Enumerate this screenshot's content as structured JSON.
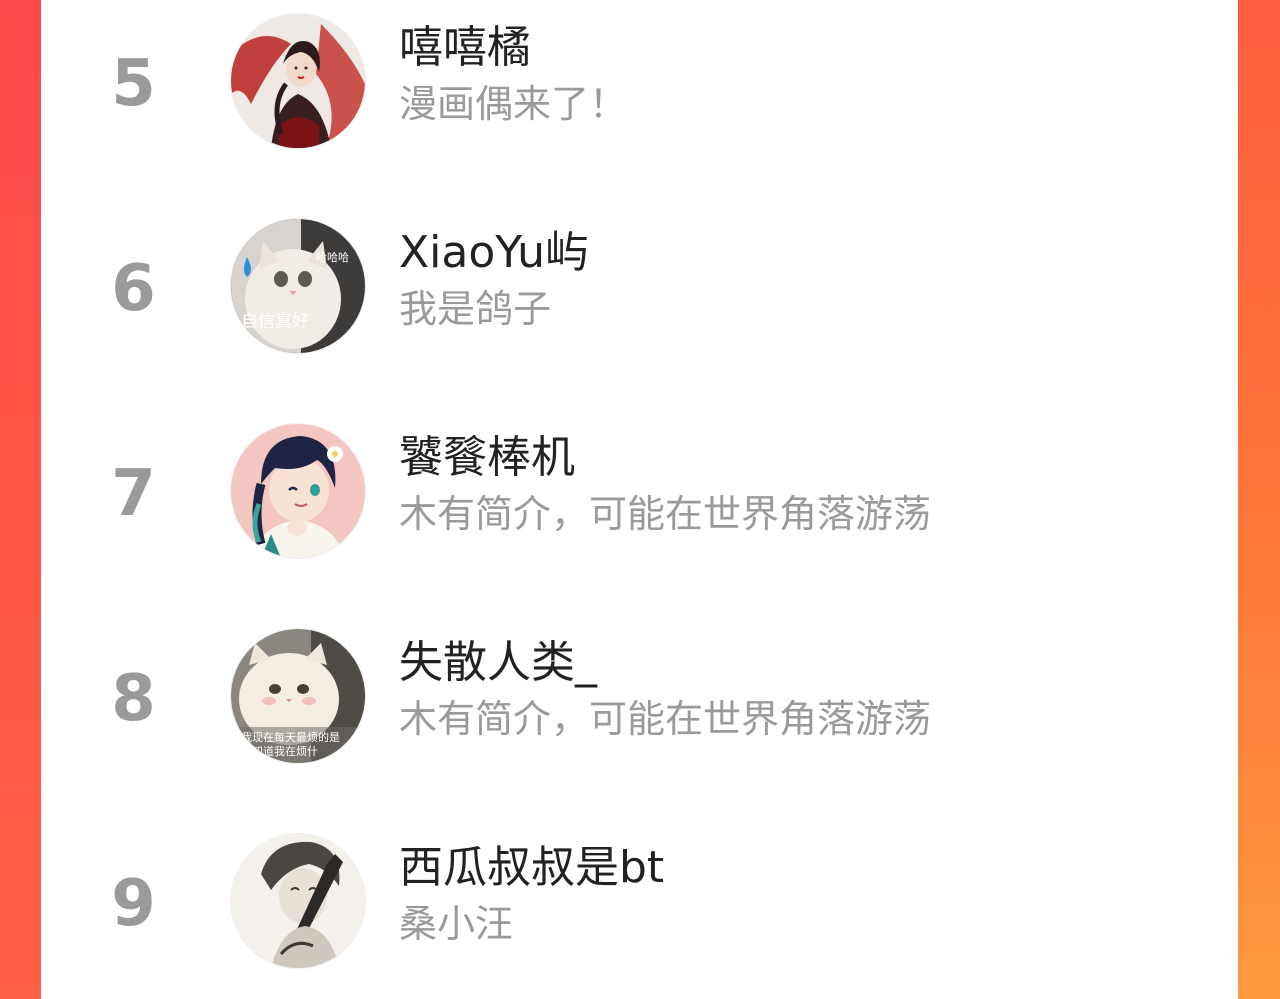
{
  "ranking": {
    "items": [
      {
        "rank": "5",
        "name": "嘻嘻橘",
        "bio": "漫画偶来了！",
        "avatar": "anime-girl-red-robe-avatar"
      },
      {
        "rank": "6",
        "name": "XiaoYu屿",
        "bio": "我是鸽子",
        "avatar": "white-cat-meme-avatar",
        "avatar_caption_top": "哈哈哈",
        "avatar_caption_bottom": "自信真好"
      },
      {
        "rank": "7",
        "name": "饕餮棒机",
        "bio": "木有简介，可能在世界角落游荡",
        "avatar": "anime-boy-braid-avatar"
      },
      {
        "rank": "8",
        "name": "失散人类_",
        "bio": "木有简介，可能在世界角落游荡",
        "avatar": "fluffy-cat-meme-avatar",
        "avatar_caption_top": "我现在每天最烦的是",
        "avatar_caption_bottom": "不知道我在烦什"
      },
      {
        "rank": "9",
        "name": "西瓜叔叔是bt",
        "bio": "桑小汪",
        "avatar": "sketch-man-rifle-avatar"
      }
    ]
  },
  "colors": {
    "frame": "#ff5a45",
    "rank": "#9a9a9a",
    "name": "#222222",
    "bio": "#9a9a9a"
  }
}
